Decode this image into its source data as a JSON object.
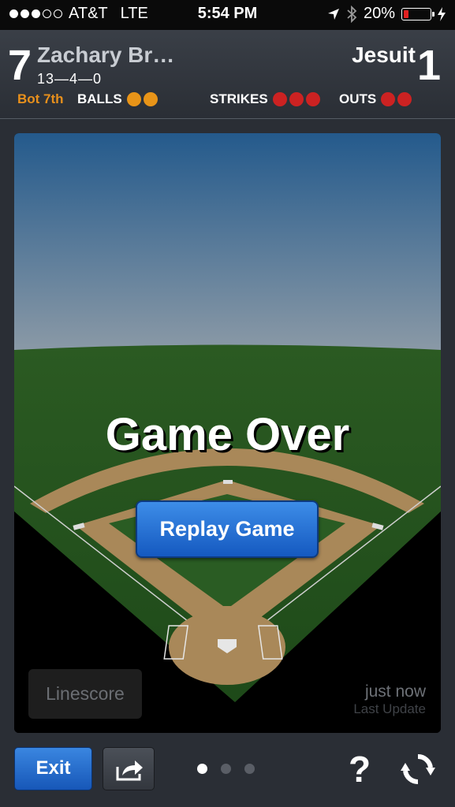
{
  "status_bar": {
    "carrier": "AT&T",
    "network": "LTE",
    "time": "5:54 PM",
    "battery": "20%",
    "battery_level": 0.2,
    "signal_bars": 3,
    "icons": [
      "signal-dots-icon",
      "location-arrow-icon",
      "bluetooth-icon",
      "battery-icon",
      "charging-bolt-icon"
    ]
  },
  "scoreboard": {
    "away": {
      "name": "Zachary Br…",
      "score": "7",
      "record": "13—4—0"
    },
    "home": {
      "name": "Jesuit",
      "score": "1"
    },
    "inning": "Bot 7th",
    "balls": {
      "label": "BALLS",
      "count": 2
    },
    "strikes": {
      "label": "STRIKES",
      "count": 3
    },
    "outs": {
      "label": "OUTS",
      "count": 2
    },
    "colors": {
      "inning": "#e8901c",
      "ball": "#e89418",
      "strike": "#cc2222",
      "out": "#cc2222"
    }
  },
  "field": {
    "title": "Game Over",
    "replay_label": "Replay Game",
    "linescore_label": "Linescore",
    "updated_time": "just now",
    "updated_label": "Last Update"
  },
  "toolbar": {
    "exit_label": "Exit",
    "share_icon": "share-icon",
    "help_label": "?",
    "refresh_icon": "refresh-icon",
    "pages": 3,
    "active_page": 0
  }
}
